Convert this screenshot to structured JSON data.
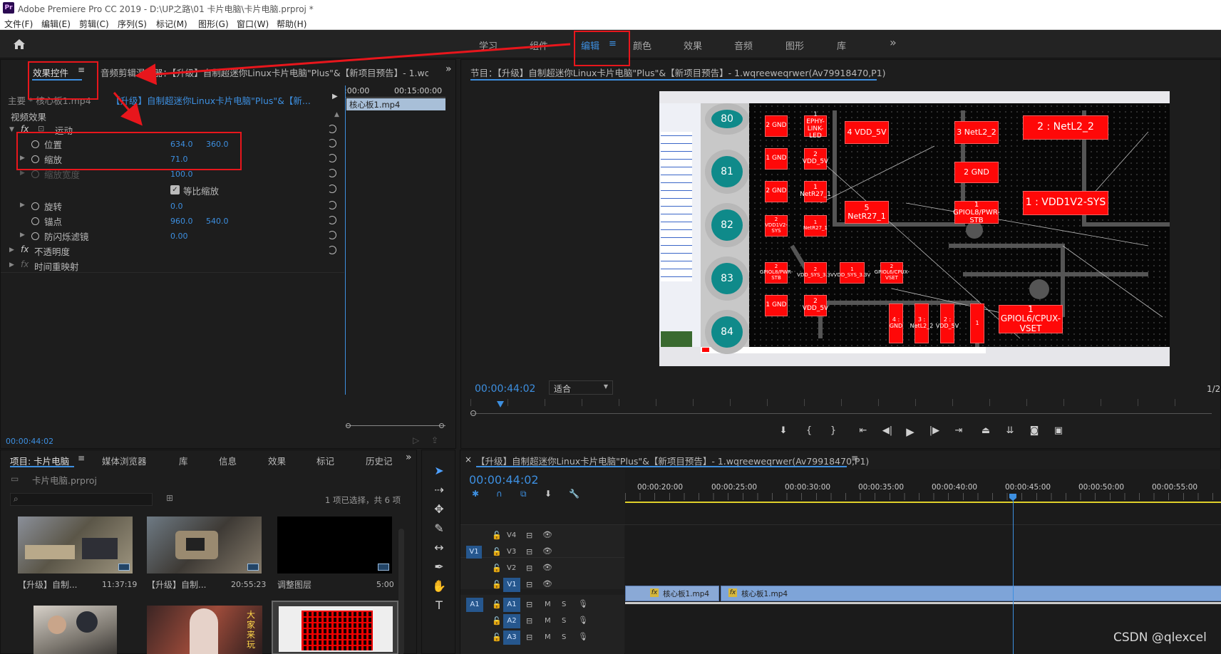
{
  "app": {
    "icon_text": "Pr",
    "title": "Adobe Premiere Pro CC 2019 - D:\\UP之路\\01 卡片电脑\\卡片电脑.prproj *"
  },
  "menu": [
    "文件(F)",
    "编辑(E)",
    "剪辑(C)",
    "序列(S)",
    "标记(M)",
    "图形(G)",
    "窗口(W)",
    "帮助(H)"
  ],
  "workspaces": {
    "tabs": [
      "学习",
      "组件",
      "编辑",
      "颜色",
      "效果",
      "音频",
      "图形",
      "库"
    ],
    "active": "编辑",
    "more": "»"
  },
  "effect_controls": {
    "tab_label": "效果控件",
    "tab2": "音频剪辑混合器：【升级】自制超迷你Linux卡片电脑\"Plus\"&【新项目预告】- 1.wq",
    "master_label": "主要 * 核心板1.mp4",
    "sequence_label": "【升级】自制超迷你Linux卡片电脑\"Plus\"&【新...",
    "ruler_start": ":00:00",
    "ruler_end": "00:15:00:00",
    "clip_label": "核心板1.mp4",
    "section": "视频效果",
    "motion": "运动",
    "position_label": "位置",
    "position_x": "634.0",
    "position_y": "360.0",
    "scale_label": "缩放",
    "scale": "71.0",
    "scale_width_label": "缩放宽度",
    "scale_width": "100.0",
    "uniform_scale_label": "等比缩放",
    "rotation_label": "旋转",
    "rotation": "0.0",
    "anchor_label": "锚点",
    "anchor_x": "960.0",
    "anchor_y": "540.0",
    "flicker_label": "防闪烁滤镜",
    "flicker": "0.00",
    "opacity_label": "不透明度",
    "time_remap_label": "时间重映射",
    "timecode": "00:00:44:02"
  },
  "program": {
    "title": "节目：【升级】自制超迷你Linux卡片电脑\"Plus\"&【新项目预告】- 1.wqreeweqrwer(Av79918470,P1)",
    "timecode": "00:00:44:02",
    "fit_label": "适合",
    "fraction": "1/2"
  },
  "pcb": {
    "pads": [
      "80",
      "81",
      "82",
      "83",
      "84"
    ],
    "components": [
      "2 GND",
      "1 EPHY-LINK-LED",
      "4 VDD_5V",
      "3 NetL2_2",
      "2 : NetL2_2",
      "1 GND",
      "2 VDD_5V",
      "2 GND",
      "2 GND",
      "1 NetR27_1",
      "5 NetR27_1",
      "1 GPIOL8/PWR-STB",
      "1 : VDD1V2-SYS",
      "2 VDD1V2-SYS",
      "1 NetR27_1",
      "2 GPIOL8/PWR-STB",
      "2 VDD_SYS_3.3V",
      "1 VDD_SYS_3.3V",
      "2 GPIOL6/CPUX-VSET",
      "1 GND",
      "2 VDD_5V",
      "4 : GND",
      "3 : NetL2_2",
      "2 : VDD_5V",
      "1",
      "1 GPIOL6/CPUX-VSET"
    ]
  },
  "project": {
    "tabs": [
      "项目: 卡片电脑",
      "媒体浏览器",
      "库",
      "信息",
      "效果",
      "标记",
      "历史记"
    ],
    "file": "卡片电脑.prproj",
    "selection": "1 项已选择，共 6 项",
    "items": [
      {
        "name": "【升级】自制...",
        "duration": "11:37:19"
      },
      {
        "name": "【升级】自制...",
        "duration": "20:55:23"
      },
      {
        "name": "调整图层",
        "duration": "5:00"
      }
    ],
    "thumb_text": "大家来玩"
  },
  "timeline": {
    "title": "【升级】自制超迷你Linux卡片电脑\"Plus\"&【新项目预告】- 1.wqreeweqrwer(Av79918470,P1)",
    "timecode": "00:00:44:02",
    "ruler": [
      "00:00:20:00",
      "00:00:25:00",
      "00:00:30:00",
      "00:00:35:00",
      "00:00:40:00",
      "00:00:45:00",
      "00:00:50:00",
      "00:00:55:00"
    ],
    "video_tracks": [
      "V4",
      "V3",
      "V2",
      "V1"
    ],
    "audio_tracks": [
      "A1",
      "A2",
      "A3"
    ],
    "source_v": "V1",
    "source_a": "A1",
    "clip1": "核心板1.mp4",
    "clip2": "核心板1.mp4",
    "track_m": "M",
    "track_s": "S"
  },
  "watermark": "CSDN @qlexcel",
  "colors": {
    "accent": "#3d8fe0",
    "annotation": "#e8161c",
    "clip": "#7ea4d8",
    "playhead": "#3d8fe0"
  }
}
